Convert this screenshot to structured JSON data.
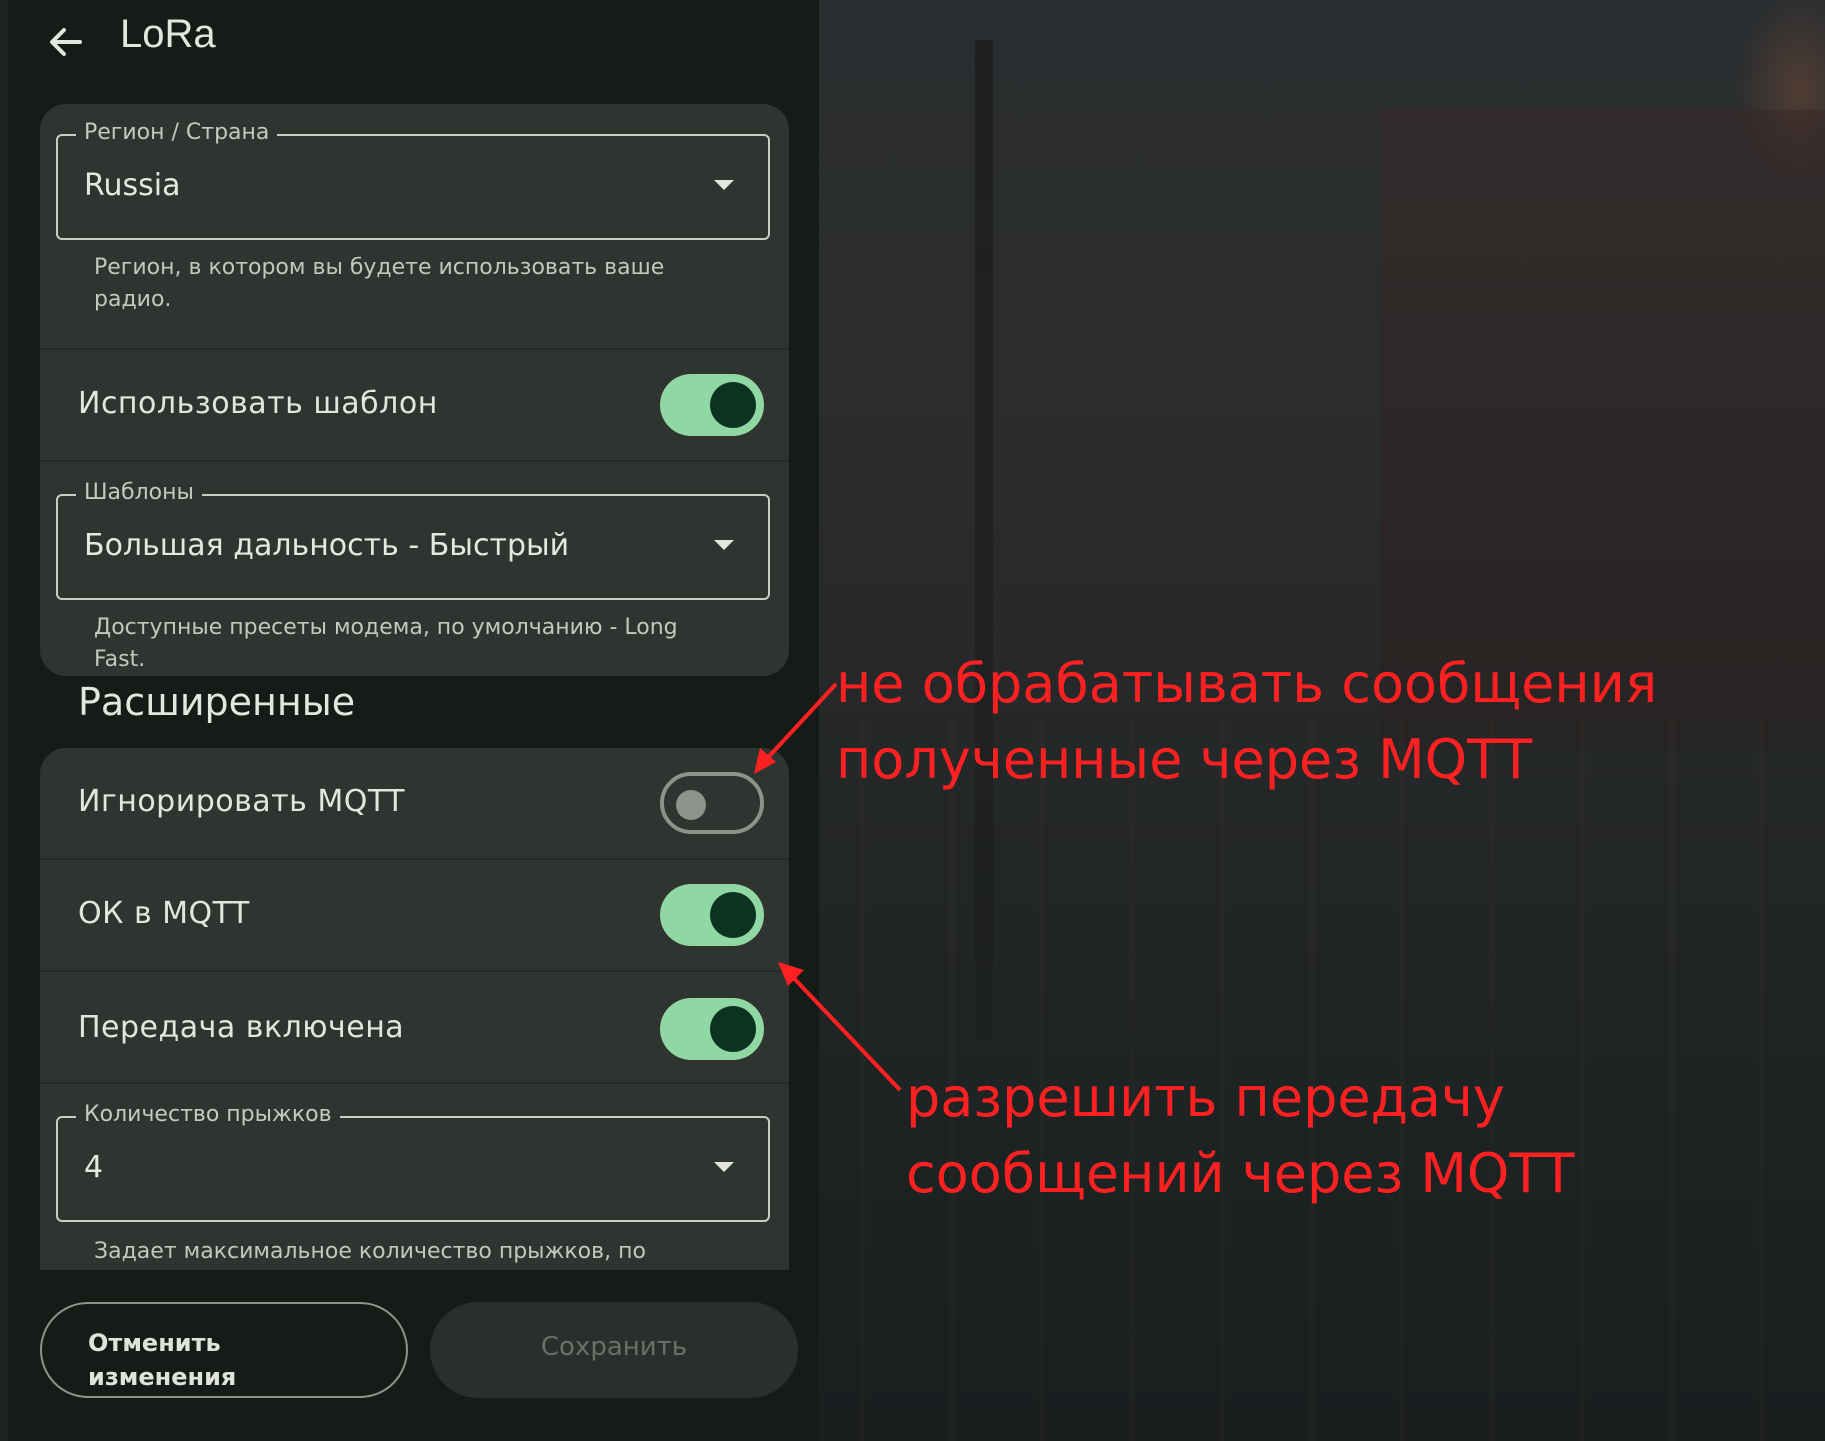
{
  "header": {
    "title": "LoRa"
  },
  "lora": {
    "region": {
      "label": "Регион / Страна",
      "value": "Russia",
      "helper": "Регион, в котором вы будете использовать ваше радио."
    },
    "use_preset": {
      "label": "Использовать шаблон",
      "on": true
    },
    "presets": {
      "label": "Шаблоны",
      "value": "Большая дальность - Быстрый",
      "helper": "Доступные пресеты модема, по умолчанию - Long Fast."
    }
  },
  "advanced": {
    "title": "Расширенные",
    "ignore_mqtt": {
      "label": "Игнорировать MQTT",
      "on": false
    },
    "ok_to_mqtt": {
      "label": "ОК в MQTT",
      "on": true
    },
    "tx_enabled": {
      "label": "Передача включена",
      "on": true
    },
    "hop_limit": {
      "label": "Количество прыжков",
      "value": "4",
      "helper": "Задает максимальное количество прыжков, по"
    }
  },
  "actions": {
    "cancel_label": "Отменить изменения",
    "save_label": "Сохранить"
  },
  "annotations": {
    "ignore_note": "не обрабатывать сообщения полученные через MQTT",
    "ok_note": "разрешить передачу сообщений через MQTT"
  },
  "colors": {
    "switch_on_track": "#8fd8a3",
    "switch_on_knob": "#0c3320",
    "annotation": "#ff2121"
  }
}
